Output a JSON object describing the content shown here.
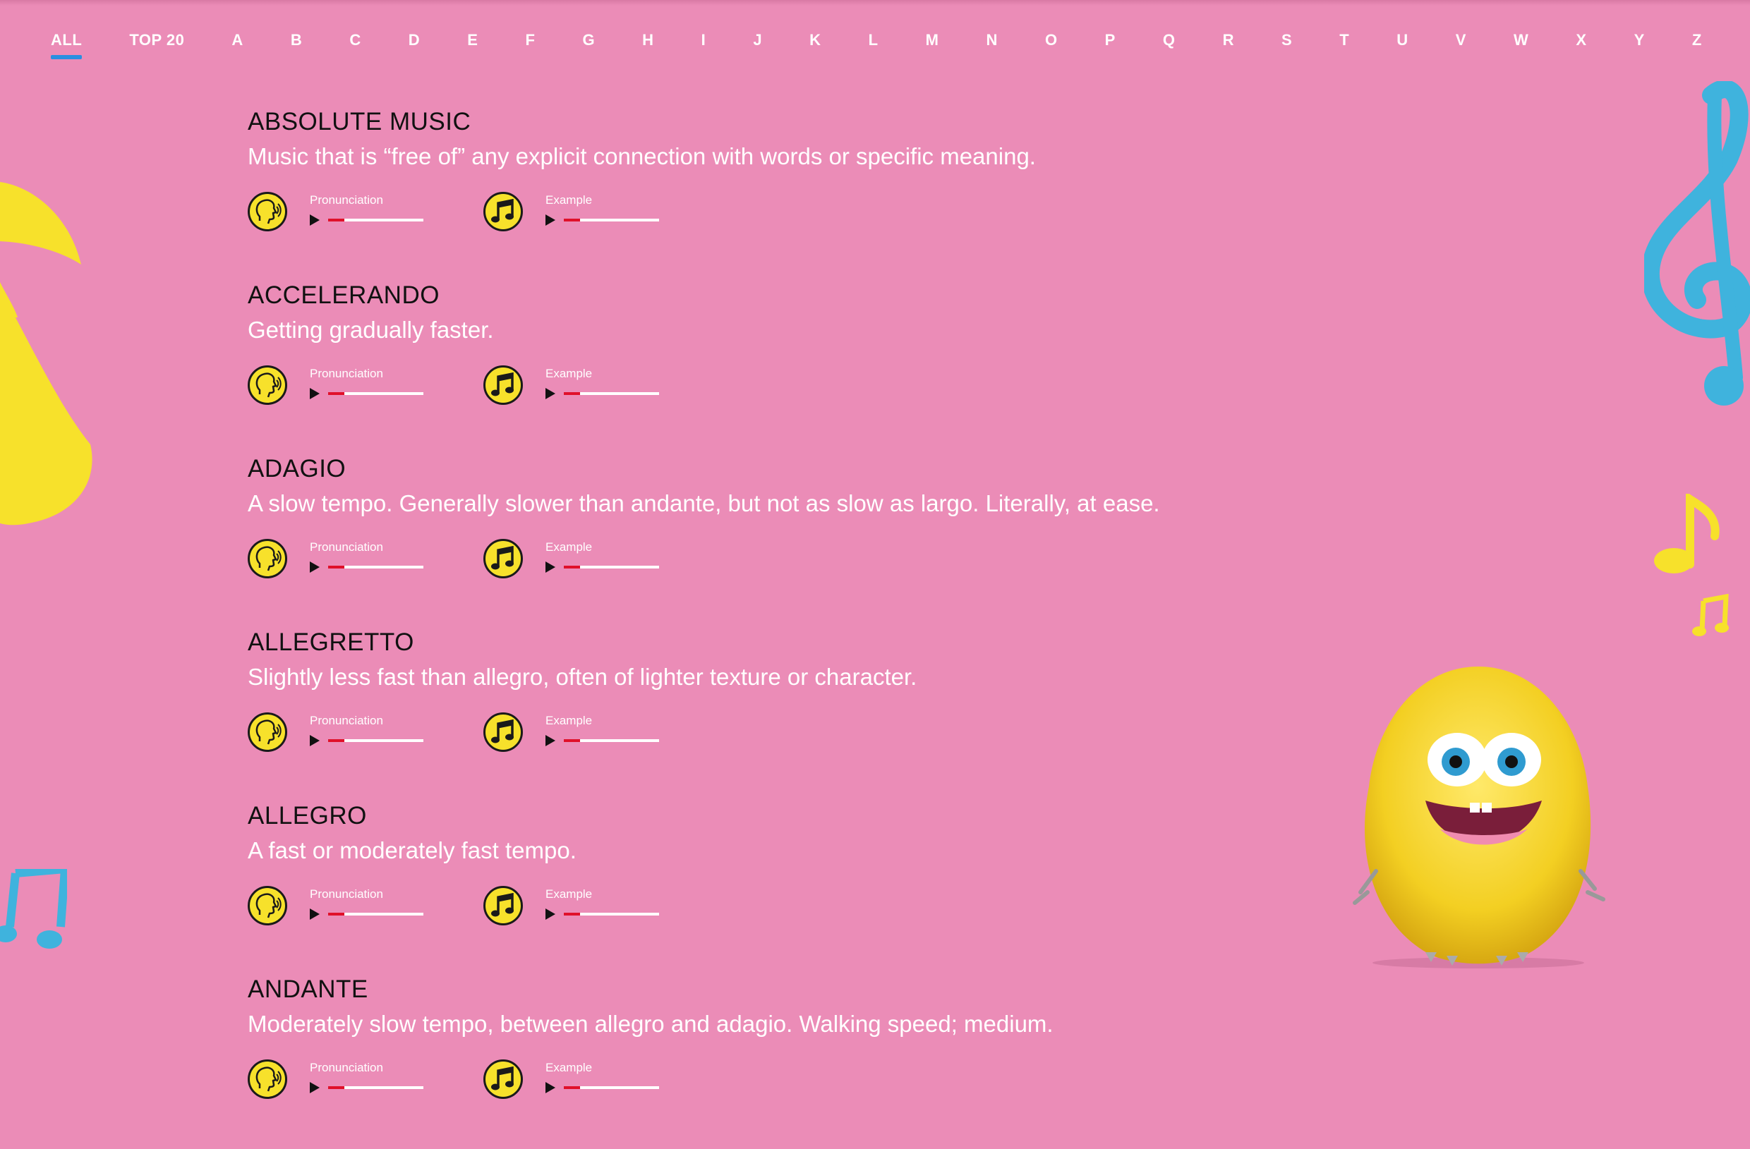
{
  "nav": {
    "items": [
      "ALL",
      "TOP 20",
      "A",
      "B",
      "C",
      "D",
      "E",
      "F",
      "G",
      "H",
      "I",
      "J",
      "K",
      "L",
      "M",
      "N",
      "O",
      "P",
      "Q",
      "R",
      "S",
      "T",
      "U",
      "V",
      "W",
      "X",
      "Y",
      "Z"
    ],
    "active": "ALL"
  },
  "entries": [
    {
      "term": "ABSOLUTE MUSIC",
      "definition": "Music that is “free of” any explicit connection with words or specific meaning.",
      "pronunciation_label": "Pronunciation",
      "example_label": "Example",
      "pronunciation_progress": 0.17,
      "example_progress": 0.17
    },
    {
      "term": "ACCELERANDO",
      "definition": "Getting gradually faster.",
      "pronunciation_label": "Pronunciation",
      "example_label": "Example",
      "pronunciation_progress": 0.17,
      "example_progress": 0.17
    },
    {
      "term": "ADAGIO",
      "definition": "A slow tempo. Generally slower than andante, but not as slow as largo. Literally, at ease.",
      "pronunciation_label": "Pronunciation",
      "example_label": "Example",
      "pronunciation_progress": 0.17,
      "example_progress": 0.17
    },
    {
      "term": "ALLEGRETTO",
      "definition": "Slightly less fast than allegro, often of lighter texture or character.",
      "pronunciation_label": "Pronunciation",
      "example_label": "Example",
      "pronunciation_progress": 0.17,
      "example_progress": 0.17
    },
    {
      "term": "ALLEGRO",
      "definition": "A fast or moderately fast tempo.",
      "pronunciation_label": "Pronunciation",
      "example_label": "Example",
      "pronunciation_progress": 0.17,
      "example_progress": 0.17
    },
    {
      "term": "ANDANTE",
      "definition": "Moderately slow tempo, between allegro and adagio. Walking speed; medium.",
      "pronunciation_label": "Pronunciation",
      "example_label": "Example",
      "pronunciation_progress": 0.17,
      "example_progress": 0.17
    }
  ],
  "icons": {
    "pronunciation": "speaking-head-icon",
    "example": "music-note-icon",
    "play": "play-icon"
  },
  "colors": {
    "background": "#EB8CB7",
    "accent_yellow": "#F7E12B",
    "accent_blue": "#3FB3DD",
    "progress_red": "#E0102A",
    "active_tab_underline": "#2A8FE0"
  }
}
